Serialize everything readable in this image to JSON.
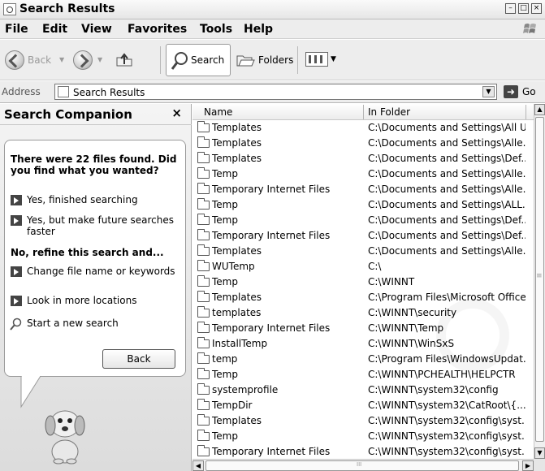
{
  "window": {
    "title": "Search Results",
    "controls": [
      "minimize",
      "maximize",
      "close"
    ]
  },
  "menu": {
    "items": [
      "File",
      "Edit",
      "View",
      "Favorites",
      "Tools",
      "Help"
    ]
  },
  "toolbar": {
    "back_label": "Back",
    "search_label": "Search",
    "folders_label": "Folders"
  },
  "address": {
    "label": "Address",
    "value": "Search Results",
    "go_label": "Go"
  },
  "companion": {
    "title": "Search Companion",
    "close": "×",
    "found_text": "There were 22 files found. Did you find what you wanted?",
    "yes_finished": "Yes, finished searching",
    "yes_future": "Yes, but make future searches faster",
    "refine_heading": "No, refine this search and...",
    "change_name": "Change file name or keywords",
    "more_locations": "Look in more locations",
    "new_search": "Start a new search",
    "back_button": "Back"
  },
  "results": {
    "columns": [
      "Name",
      "In Folder"
    ],
    "rows": [
      {
        "name": "Templates",
        "folder": "C:\\Documents and Settings\\All U..."
      },
      {
        "name": "Templates",
        "folder": "C:\\Documents and Settings\\Alle..."
      },
      {
        "name": "Templates",
        "folder": "C:\\Documents and Settings\\Def..."
      },
      {
        "name": "Temp",
        "folder": "C:\\Documents and Settings\\Alle..."
      },
      {
        "name": "Temporary Internet Files",
        "folder": "C:\\Documents and Settings\\Alle..."
      },
      {
        "name": "Temp",
        "folder": "C:\\Documents and Settings\\ALL..."
      },
      {
        "name": "Temp",
        "folder": "C:\\Documents and Settings\\Def..."
      },
      {
        "name": "Temporary Internet Files",
        "folder": "C:\\Documents and Settings\\Def..."
      },
      {
        "name": "Templates",
        "folder": "C:\\Documents and Settings\\Alle..."
      },
      {
        "name": "WUTemp",
        "folder": "C:\\"
      },
      {
        "name": "Temp",
        "folder": "C:\\WINNT"
      },
      {
        "name": "Templates",
        "folder": "C:\\Program Files\\Microsoft Office"
      },
      {
        "name": "templates",
        "folder": "C:\\WINNT\\security"
      },
      {
        "name": "Temporary Internet Files",
        "folder": "C:\\WINNT\\Temp"
      },
      {
        "name": "InstallTemp",
        "folder": "C:\\WINNT\\WinSxS"
      },
      {
        "name": "temp",
        "folder": "C:\\Program Files\\WindowsUpdat..."
      },
      {
        "name": "Temp",
        "folder": "C:\\WINNT\\PCHEALTH\\HELPCTR"
      },
      {
        "name": "systemprofile",
        "folder": "C:\\WINNT\\system32\\config"
      },
      {
        "name": "TempDir",
        "folder": "C:\\WINNT\\system32\\CatRoot\\{..."
      },
      {
        "name": "Templates",
        "folder": "C:\\WINNT\\system32\\config\\syst..."
      },
      {
        "name": "Temp",
        "folder": "C:\\WINNT\\system32\\config\\syst..."
      },
      {
        "name": "Temporary Internet Files",
        "folder": "C:\\WINNT\\system32\\config\\syst..."
      }
    ]
  }
}
